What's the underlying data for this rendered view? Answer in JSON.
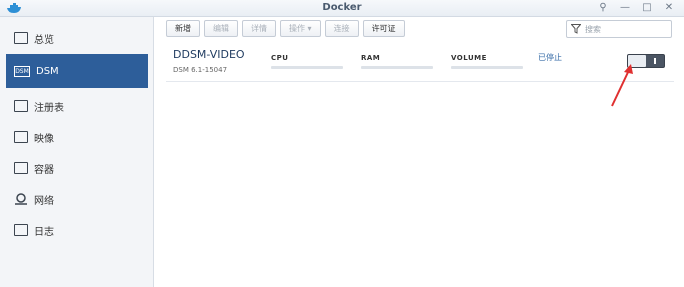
{
  "window": {
    "title": "Docker",
    "controls": [
      "pin",
      "minimize",
      "maximize",
      "close"
    ]
  },
  "sidebar": {
    "items": [
      {
        "label": "总览",
        "icon": "overview-icon",
        "active": false
      },
      {
        "label": "DSM",
        "icon": "dsm-icon",
        "active": true
      },
      {
        "label": "注册表",
        "icon": "registry-icon",
        "active": false
      },
      {
        "label": "映像",
        "icon": "image-icon",
        "active": false
      },
      {
        "label": "容器",
        "icon": "container-icon",
        "active": false
      },
      {
        "label": "网络",
        "icon": "network-icon",
        "active": false
      },
      {
        "label": "日志",
        "icon": "log-icon",
        "active": false
      }
    ]
  },
  "toolbar": {
    "buttons": [
      {
        "label": "新增",
        "enabled": true
      },
      {
        "label": "编辑",
        "enabled": false
      },
      {
        "label": "详情",
        "enabled": false
      },
      {
        "label": "操作 ▾",
        "enabled": false
      },
      {
        "label": "连接",
        "enabled": false
      },
      {
        "label": "许可证",
        "enabled": true
      }
    ],
    "search": {
      "placeholder": "搜索",
      "icon": "filter-icon"
    }
  },
  "container": {
    "name": "DDSM-VIDEO",
    "version": "DSM 6.1-15047",
    "metrics": [
      {
        "label": "CPU",
        "value": 0
      },
      {
        "label": "RAM",
        "value": 0
      },
      {
        "label": "VOLUME",
        "value": 0
      }
    ],
    "status": "已停止",
    "running": false
  },
  "colors": {
    "accent": "#2d5e9a",
    "annotation": "#e03030"
  }
}
